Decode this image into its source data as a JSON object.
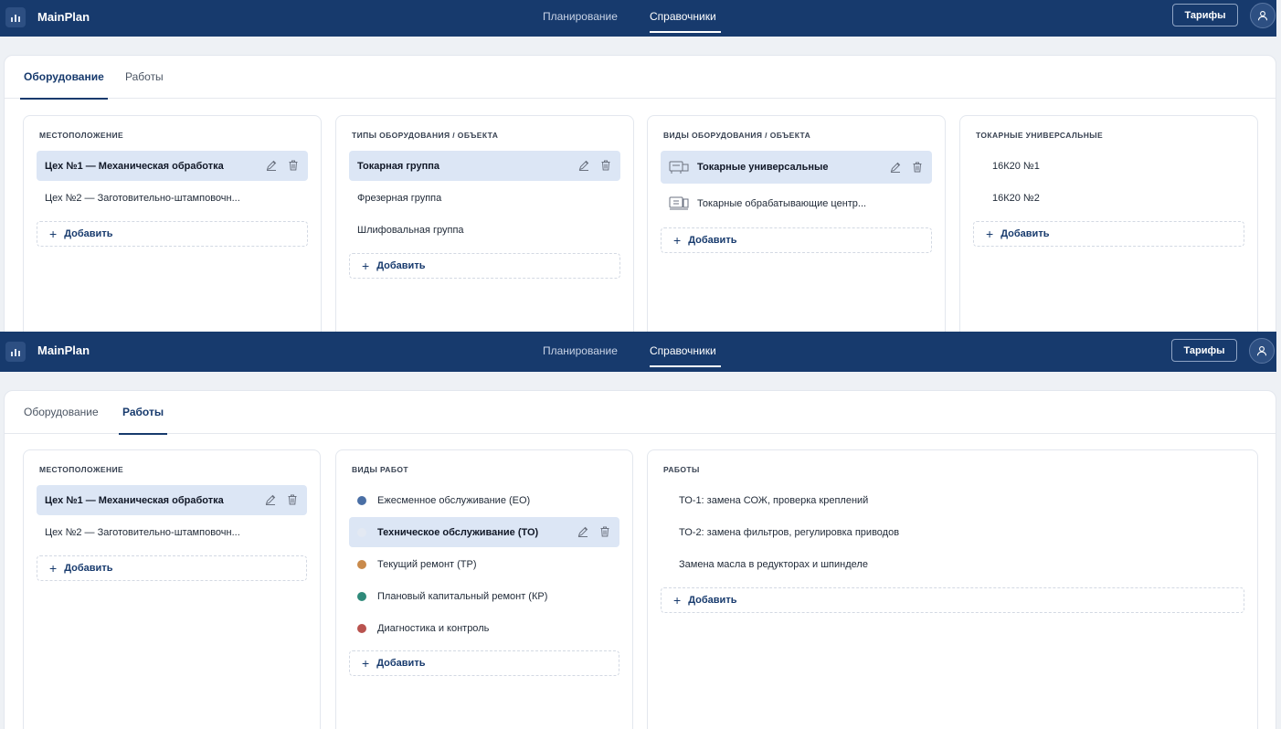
{
  "app": {
    "brand": "MainPlan",
    "nav": [
      "Планирование",
      "Справочники"
    ],
    "tariff_label": "Тарифы"
  },
  "screen1": {
    "tabs": [
      "Оборудование",
      "Работы"
    ],
    "columns": {
      "location": {
        "title": "МЕСТОПОЛОЖЕНИЕ",
        "items": [
          "Цех №1 — Механическая обработка",
          "Цех №2 — Заготовительно-штамповочн..."
        ]
      },
      "equip_types": {
        "title": "ТИПЫ ОБОРУДОВАНИЯ / ОБЪЕКТА",
        "items": [
          "Токарная группа",
          "Фрезерная группа",
          "Шлифовальная группа"
        ]
      },
      "equip_kinds": {
        "title": "ВИДЫ ОБОРУДОВАНИЯ / ОБЪЕКТА",
        "items": [
          "Токарные универсальные",
          "Токарные обрабатывающие центр..."
        ]
      },
      "units": {
        "title": "ТОКАРНЫЕ УНИВЕРСАЛЬНЫЕ",
        "items": [
          "16К20 №1",
          "16К20 №2"
        ]
      }
    },
    "add_label": "Добавить"
  },
  "screen2": {
    "tabs": [
      "Оборудование",
      "Работы"
    ],
    "columns": {
      "location": {
        "title": "МЕСТОПОЛОЖЕНИЕ",
        "items": [
          "Цех №1 — Механическая обработка",
          "Цех №2 — Заготовительно-штамповочн..."
        ]
      },
      "work_kinds": {
        "title": "ВИДЫ РАБОТ",
        "items": [
          {
            "label": "Ежесменное обслуживание (ЕО)",
            "color": "#4a6fa5"
          },
          {
            "label": "Техническое обслуживание (ТО)",
            "color": "#e3e9f3"
          },
          {
            "label": "Текущий ремонт (ТР)",
            "color": "#c98a4b"
          },
          {
            "label": "Плановый капитальный ремонт (КР)",
            "color": "#2f8a7a"
          },
          {
            "label": "Диагностика и контроль",
            "color": "#b9534f"
          }
        ]
      },
      "works": {
        "title": "РАБОТЫ",
        "items": [
          "ТО-1: замена СОЖ, проверка креплений",
          "ТО-2: замена фильтров, регулировка приводов",
          "Замена масла в редукторах и шпинделе"
        ]
      }
    },
    "add_label": "Добавить"
  }
}
